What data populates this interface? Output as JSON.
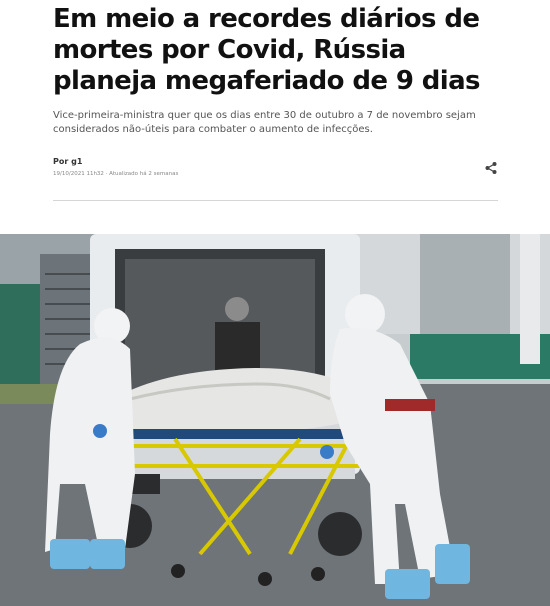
{
  "article": {
    "headline": "Em meio a recordes diários de mortes por Covid, Rússia planeja megaferiado de 9 dias",
    "subtitle": "Vice-primeira-ministra quer que os dias entre 30 de outubro a 7 de novembro sejam considerados não-úteis para combater o aumento de infecções.",
    "byline": "Por g1",
    "dateline": "19/10/2021 11h32 · Atualizado há 2 semanas"
  },
  "icons": {
    "share": "share-icon"
  },
  "colors": {
    "headline": "#111111",
    "subtitle": "#555555",
    "divider": "#d6d6d6"
  }
}
